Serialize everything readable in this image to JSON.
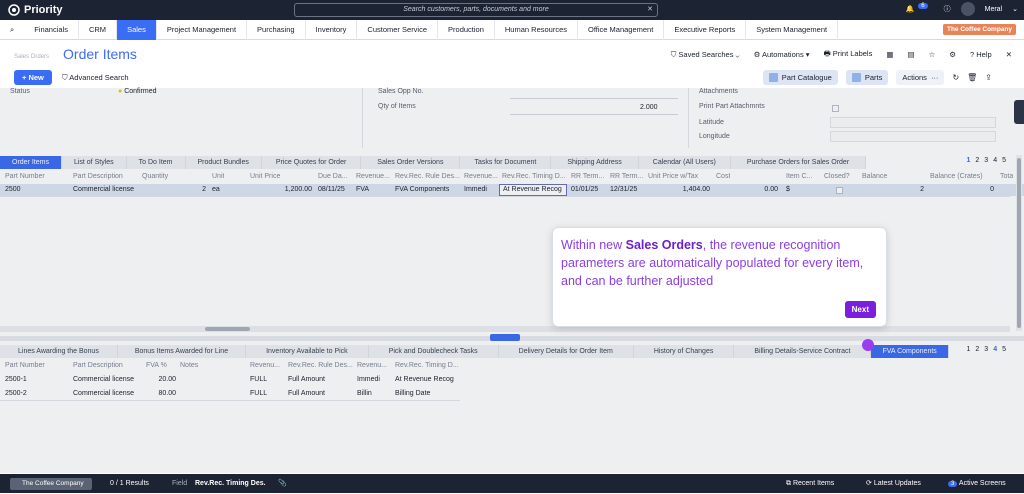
{
  "app": {
    "name": "Priority",
    "search_placeholder": "Search customers, parts, documents and more",
    "user": "Meral",
    "notif_count": "6",
    "company": "The Coffee Company"
  },
  "menu": [
    "Financials",
    "CRM",
    "Sales",
    "Project Management",
    "Purchasing",
    "Inventory",
    "Customer Service",
    "Production",
    "Human Resources",
    "Office Management",
    "Executive Reports",
    "System Management"
  ],
  "page": {
    "breadcrumb": "Sales Orders",
    "title": "Order Items",
    "saved": "Saved Searches",
    "automations": "Automations",
    "print": "Print Labels",
    "help": "Help"
  },
  "toolbar": {
    "new": "New",
    "advanced": "Advanced Search",
    "catalogue": "Part Catalogue",
    "parts": "Parts",
    "actions": "Actions"
  },
  "form": {
    "status_label": "Status",
    "status_value": "Confirmed",
    "sales_opp": "Sales Opp No.",
    "qty_label": "Qty of Items",
    "qty_value": "2.000",
    "attachments": "Attachments",
    "print_attach": "Print Part Attachmnts",
    "latitude": "Latitude",
    "longitude": "Longitude"
  },
  "tabs_top": [
    "Order Items",
    "List of Styles",
    "To Do Item",
    "Product Bundles",
    "Price Quotes for Order",
    "Sales Order Versions",
    "Tasks for Document",
    "Shipping Address",
    "Calendar (All Users)",
    "Purchase Orders for Sales Order"
  ],
  "pager_top": [
    "1",
    "2",
    "3",
    "4",
    "5"
  ],
  "grid_top": {
    "headers": [
      "Part Number",
      "Part Description",
      "Quantity",
      "Unit",
      "Unit Price",
      "Due Da...",
      "Revenue...",
      "Rev.Rec. Rule Des...",
      "Revenue...",
      "Rev.Rec. Timing D...",
      "RR Term...",
      "RR Term...",
      "Unit Price w/Tax",
      "Cost",
      "Item C...",
      "Closed?",
      "Balance",
      "Balance (Crates)",
      "Tota"
    ],
    "row": [
      "2500",
      "Commercial license",
      "2",
      "ea",
      "1,200.00",
      "08/11/25",
      "FVA",
      "FVA Components",
      "Immedi",
      "At Revenue Recog",
      "01/01/25",
      "12/31/25",
      "1,404.00",
      "0.00",
      "$",
      "",
      "2",
      "0",
      ""
    ]
  },
  "tabs_bottom": [
    "Lines Awarding the Bonus",
    "Bonus Items Awarded for Line",
    "Inventory Available to Pick",
    "Pick and Doublecheck Tasks",
    "Delivery Details for Order Item",
    "History of Changes",
    "Billing Details-Service Contract",
    "FVA Components"
  ],
  "pager_bottom": [
    "1",
    "2",
    "3",
    "4",
    "5"
  ],
  "grid_bottom": {
    "headers": [
      "Part Number",
      "Part Description",
      "FVA %",
      "Notes",
      "Revenu...",
      "Rev.Rec. Rule Des...",
      "Revenu...",
      "Rev.Rec. Timing D..."
    ],
    "rows": [
      [
        "2500-1",
        "Commercial license",
        "20.00",
        "",
        "FULL",
        "Full Amount",
        "Immedi",
        "At Revenue Recog"
      ],
      [
        "2500-2",
        "Commercial license",
        "80.00",
        "",
        "FULL",
        "Full Amount",
        "Billin",
        "Billing Date"
      ]
    ]
  },
  "tooltip": {
    "pre": "Within new ",
    "bold": "Sales Orders",
    "post": ", the revenue recognition parameters are automatically populated for every item, and can be further adjusted",
    "next": "Next"
  },
  "status": {
    "company": "The Coffee Company",
    "results": "0 / 1 Results",
    "field_label": "Field",
    "field_value": "Rev.Rec. Timing Des.",
    "recent": "Recent Items",
    "latest": "Latest Updates",
    "active": "Active Screens",
    "active_count": "3"
  }
}
